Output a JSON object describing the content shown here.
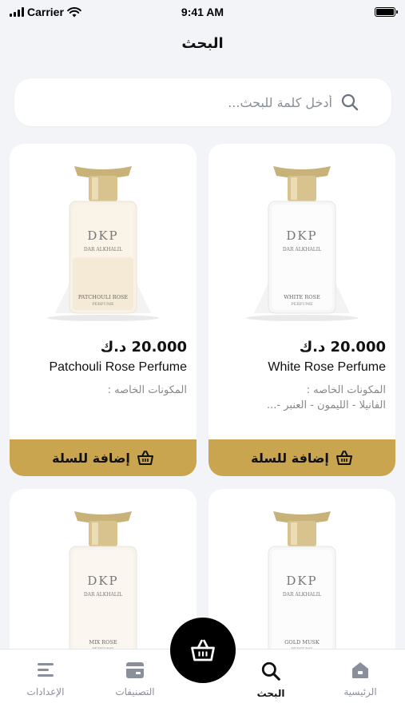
{
  "status_bar": {
    "carrier": "Carrier",
    "time": "9:41 AM"
  },
  "header": {
    "title": "البحث"
  },
  "search": {
    "placeholder": "أدخل كلمة للبحث..."
  },
  "products": [
    {
      "name": "White Rose Perfume",
      "price": "20.000 د.ك",
      "ingredients_label": "المكونات الخاصه :",
      "ingredients": "الفانيلا - الليمون - العنبر -...",
      "bottle_brand": "DKP",
      "bottle_house": "DAR ALKHALIL",
      "bottle_name": "WHITE ROSE",
      "bottle_sub": "PERFUME"
    },
    {
      "name": "Patchouli Rose Perfume",
      "price": "20.000 د.ك",
      "ingredients_label": "المكونات الخاصه :",
      "ingredients": "",
      "bottle_brand": "DKP",
      "bottle_house": "DAR ALKHALIL",
      "bottle_name": "PATCHOULI ROSE",
      "bottle_sub": "PERFUME"
    },
    {
      "bottle_brand": "DKP",
      "bottle_house": "DAR ALKHALIL",
      "bottle_name": "GOLD MUSK",
      "bottle_sub": "PERFUME"
    },
    {
      "bottle_brand": "DKP",
      "bottle_house": "DAR ALKHALIL",
      "bottle_name": "MIX ROSE",
      "bottle_sub": "PERFUME"
    }
  ],
  "add_to_cart_label": "إضافة للسلة",
  "tabs": [
    {
      "label": "الرئيسية",
      "icon": "home-icon"
    },
    {
      "label": "البحث",
      "icon": "search-icon"
    },
    {
      "label": "التصنيفات",
      "icon": "categories-icon"
    },
    {
      "label": "الإعدادات",
      "icon": "settings-icon"
    }
  ],
  "colors": {
    "accent": "#caa550",
    "background": "#f2f4f8",
    "tab_inactive": "#8a8f9c"
  }
}
